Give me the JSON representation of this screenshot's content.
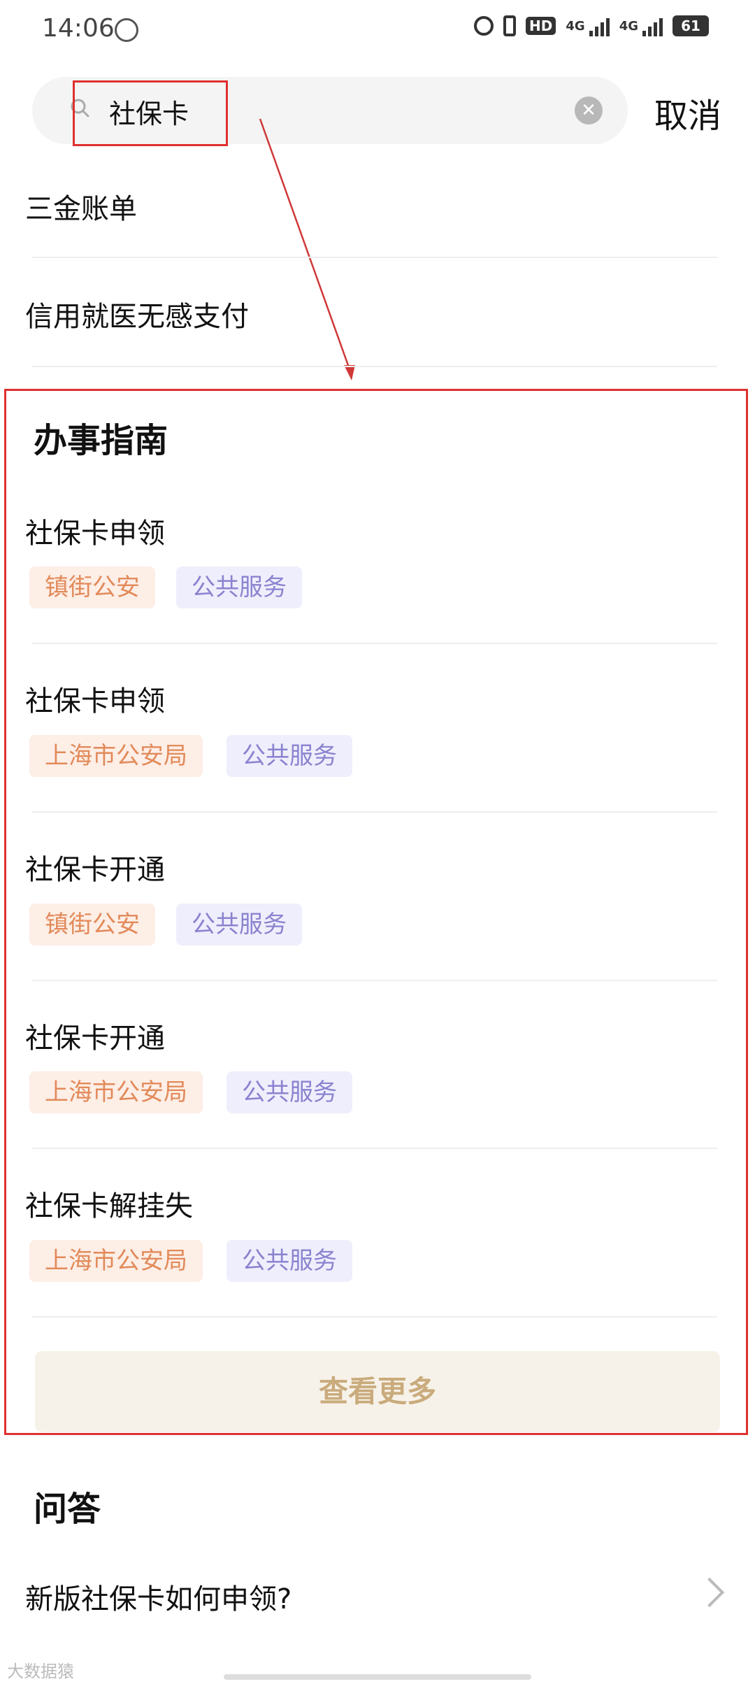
{
  "status_bar": {
    "time": "14:06",
    "hd_label": "HD",
    "net1": "4G",
    "net2": "4G",
    "battery": "61"
  },
  "search": {
    "query": "社保卡",
    "cancel_label": "取消"
  },
  "suggestions": [
    "三金账单",
    "信用就医无感支付"
  ],
  "guide": {
    "title": "办事指南",
    "items": [
      {
        "title": "社保卡申领",
        "tags": [
          "镇街公安",
          "公共服务"
        ]
      },
      {
        "title": "社保卡申领",
        "tags": [
          "上海市公安局",
          "公共服务"
        ]
      },
      {
        "title": "社保卡开通",
        "tags": [
          "镇街公安",
          "公共服务"
        ]
      },
      {
        "title": "社保卡开通",
        "tags": [
          "上海市公安局",
          "公共服务"
        ]
      },
      {
        "title": "社保卡解挂失",
        "tags": [
          "上海市公安局",
          "公共服务"
        ]
      }
    ],
    "more_label": "查看更多"
  },
  "qa": {
    "title": "问答",
    "items": [
      "新版社保卡如何申领?"
    ]
  },
  "watermark": "大数据猿",
  "colors": {
    "annotation_red": "#e03030",
    "tag_orange_bg": "#fdeee6",
    "tag_orange_text": "#e28a5a",
    "tag_purple_bg": "#efeefc",
    "tag_purple_text": "#8a83cf",
    "more_button_bg": "#f7f2e9",
    "more_button_text": "#c9ab7c"
  }
}
